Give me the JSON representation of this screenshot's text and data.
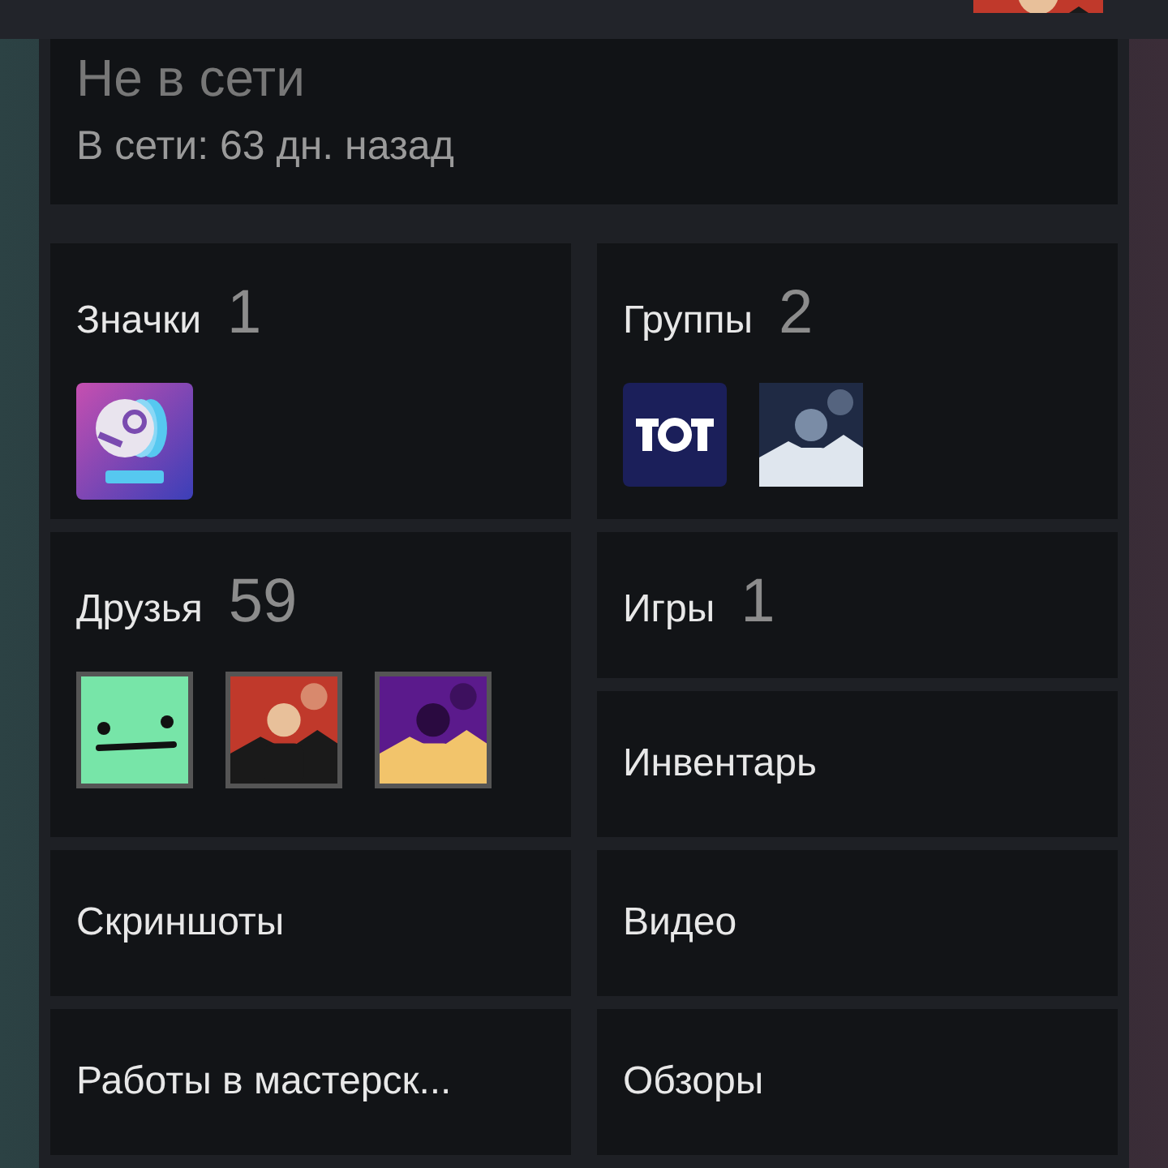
{
  "status": {
    "state": "Не в сети",
    "last_online": "В сети: 63 дн. назад"
  },
  "sections": [
    {
      "title": "Значки",
      "count": "1",
      "kind": "badges",
      "items": [
        {
          "kind": "badge"
        }
      ]
    },
    {
      "title": "Группы",
      "count": "2",
      "kind": "groups",
      "items": [
        {
          "kind": "logo"
        },
        {
          "kind": "picture"
        }
      ]
    },
    {
      "title": "Друзья",
      "count": "59",
      "kind": "friends",
      "items": [
        {
          "kind": "face"
        },
        {
          "kind": "picture"
        },
        {
          "kind": "picture"
        }
      ]
    },
    {
      "title": "Игры",
      "count": "1",
      "kind": "plain"
    },
    {
      "title": "Инвентарь",
      "kind": "plain"
    },
    {
      "title": "Скриншоты",
      "kind": "plain"
    },
    {
      "title": "Видео",
      "kind": "plain"
    },
    {
      "title": "Работы в мастерск...",
      "kind": "plain"
    },
    {
      "title": "Обзоры",
      "kind": "plain"
    }
  ]
}
